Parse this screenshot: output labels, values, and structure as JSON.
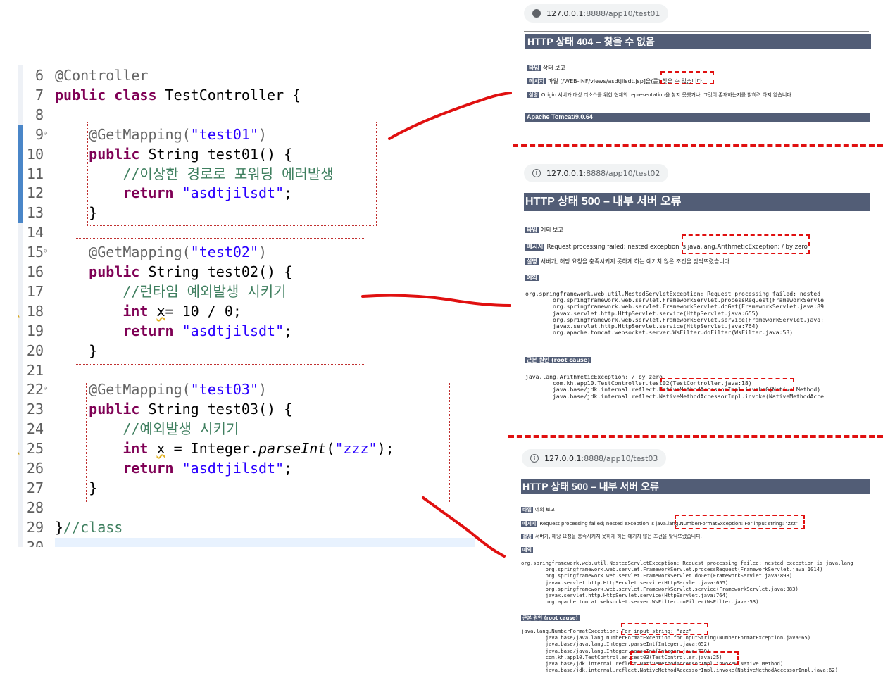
{
  "editor": {
    "lines": [
      {
        "n": "6",
        "t": [
          [
            "ann",
            "@Controller"
          ]
        ]
      },
      {
        "n": "7",
        "t": [
          [
            "kw",
            "public class "
          ],
          [
            "",
            "TestController {"
          ]
        ]
      },
      {
        "n": "8",
        "t": []
      },
      {
        "n": "9",
        "t": [
          [
            "",
            "    "
          ],
          [
            "ann",
            "@GetMapping("
          ],
          [
            "str",
            "\"test01\""
          ],
          [
            "ann",
            ")"
          ]
        ]
      },
      {
        "n": "10",
        "t": [
          [
            "",
            "    "
          ],
          [
            "kw",
            "public "
          ],
          [
            "",
            "String test01() {"
          ]
        ]
      },
      {
        "n": "11",
        "t": [
          [
            "",
            "        "
          ],
          [
            "cmt",
            "//이상한 경로로 포워딩 에러발생"
          ]
        ]
      },
      {
        "n": "12",
        "t": [
          [
            "",
            "        "
          ],
          [
            "kw",
            "return "
          ],
          [
            "str",
            "\"asdtjilsdt\""
          ],
          [
            "",
            ";"
          ]
        ]
      },
      {
        "n": "13",
        "t": [
          [
            "",
            "    }"
          ]
        ]
      },
      {
        "n": "14",
        "t": []
      },
      {
        "n": "15",
        "t": [
          [
            "",
            "    "
          ],
          [
            "ann",
            "@GetMapping("
          ],
          [
            "str",
            "\"test02\""
          ],
          [
            "ann",
            ")"
          ]
        ]
      },
      {
        "n": "16",
        "t": [
          [
            "",
            "    "
          ],
          [
            "kw",
            "public "
          ],
          [
            "",
            "String test02() {"
          ]
        ]
      },
      {
        "n": "17",
        "t": [
          [
            "",
            "        "
          ],
          [
            "cmt",
            "//런타임 예외발생 시키기"
          ]
        ]
      },
      {
        "n": "18",
        "t": [
          [
            "",
            "        "
          ],
          [
            "kw",
            "int "
          ],
          [
            "squig",
            "x"
          ],
          [
            "",
            "= 10 / 0;"
          ]
        ]
      },
      {
        "n": "19",
        "t": [
          [
            "",
            "        "
          ],
          [
            "kw",
            "return "
          ],
          [
            "str",
            "\"asdtjilsdt\""
          ],
          [
            "",
            ";"
          ]
        ]
      },
      {
        "n": "20",
        "t": [
          [
            "",
            "    }"
          ]
        ]
      },
      {
        "n": "21",
        "t": []
      },
      {
        "n": "22",
        "t": [
          [
            "",
            "    "
          ],
          [
            "ann",
            "@GetMapping("
          ],
          [
            "str",
            "\"test03\""
          ],
          [
            "ann",
            ")"
          ]
        ]
      },
      {
        "n": "23",
        "t": [
          [
            "",
            "    "
          ],
          [
            "kw",
            "public "
          ],
          [
            "",
            "String test03() {"
          ]
        ]
      },
      {
        "n": "24",
        "t": [
          [
            "",
            "        "
          ],
          [
            "cmt",
            "//예외발생 시키기"
          ]
        ]
      },
      {
        "n": "25",
        "t": [
          [
            "",
            "        "
          ],
          [
            "kw",
            "int "
          ],
          [
            "squig",
            "x"
          ],
          [
            "",
            " = Integer."
          ],
          [
            "it",
            "parseInt"
          ],
          [
            "",
            "("
          ],
          [
            "str",
            "\"zzz\""
          ],
          [
            "",
            ");"
          ]
        ]
      },
      {
        "n": "26",
        "t": [
          [
            "",
            "        "
          ],
          [
            "kw",
            "return "
          ],
          [
            "str",
            "\"asdtjilsdt\""
          ],
          [
            "",
            ";"
          ]
        ]
      },
      {
        "n": "27",
        "t": [
          [
            "",
            "    }"
          ]
        ]
      },
      {
        "n": "28",
        "t": []
      },
      {
        "n": "29",
        "t": [
          [
            "",
            "}"
          ],
          [
            "cmt",
            "//class"
          ]
        ]
      }
    ],
    "cut_line_number": "30"
  },
  "panel1": {
    "url_host": "127.0.0.1",
    "url_path": ":8888/app10/test01",
    "title": "HTTP 상태 404 – 찾을 수 없음",
    "type_label": "타입",
    "type_value": "상태 보고",
    "message_label": "메시지",
    "message_value": "파일 [/WEB-INF/views/asdtjilsdt.jsp]을(를) 찾을 수 없습니다.",
    "desc_label": "설명",
    "desc_value": "Origin 서버가 대상 리소스를 위한 현재의 representation을 찾지 못했거나, 그것이 존재하는지를 밝히려 하지 않습니다.",
    "footer": "Apache Tomcat/9.0.64"
  },
  "panel2": {
    "url_host": "127.0.0.1",
    "url_path": ":8888/app10/test02",
    "title": "HTTP 상태 500 – 내부 서버 오류",
    "type_label": "타입",
    "type_value": "예외 보고",
    "message_label": "메시지",
    "message_value": "Request processing failed; nested exception is java.lang.ArithmeticException: / by zero",
    "desc_label": "설명",
    "desc_value": "서버가, 해당 요청을 충족시키지 못하게 하는 예기치 않은 조건을 맞닥뜨렸습니다.",
    "exception_label": "예외",
    "stack": [
      "org.springframework.web.util.NestedServletException: Request processing failed; nested",
      "        org.springframework.web.servlet.FrameworkServlet.processRequest(FrameworkServle",
      "        org.springframework.web.servlet.FrameworkServlet.doGet(FrameworkServlet.java:89",
      "        javax.servlet.http.HttpServlet.service(HttpServlet.java:655)",
      "        org.springframework.web.servlet.FrameworkServlet.service(FrameworkServlet.java:",
      "        javax.servlet.http.HttpServlet.service(HttpServlet.java:764)",
      "        org.apache.tomcat.websocket.server.WsFilter.doFilter(WsFilter.java:53)"
    ],
    "root_label": "근본 원인 (root cause)",
    "root": [
      "java.lang.ArithmeticException: / by zero",
      "        com.kh.app10.TestController.test02(TestController.java:18)",
      "        java.base/jdk.internal.reflect.NativeMethodAccessorImpl.invoke0(Native Method)",
      "        java.base/jdk.internal.reflect.NativeMethodAccessorImpl.invoke(NativeMethodAcce"
    ]
  },
  "panel3": {
    "url_host": "127.0.0.1",
    "url_path": ":8888/app10/test03",
    "title": "HTTP 상태 500 – 내부 서버 오류",
    "type_label": "타입",
    "type_value": "예외 보고",
    "message_label": "메시지",
    "message_value": "Request processing failed; nested exception is java.lang.NumberFormatException: For input string: \"zzz\"",
    "desc_label": "설명",
    "desc_value": "서버가, 해당 요청을 충족시키지 못하게 하는 예기치 않은 조건을 맞닥뜨렸습니다.",
    "exception_label": "예외",
    "stack": [
      "org.springframework.web.util.NestedServletException: Request processing failed; nested exception is java.lang",
      "        org.springframework.web.servlet.FrameworkServlet.processRequest(FrameworkServlet.java:1014)",
      "        org.springframework.web.servlet.FrameworkServlet.doGet(FrameworkServlet.java:898)",
      "        javax.servlet.http.HttpServlet.service(HttpServlet.java:655)",
      "        org.springframework.web.servlet.FrameworkServlet.service(FrameworkServlet.java:883)",
      "        javax.servlet.http.HttpServlet.service(HttpServlet.java:764)",
      "        org.apache.tomcat.websocket.server.WsFilter.doFilter(WsFilter.java:53)"
    ],
    "root_label": "근본 원인 (root cause)",
    "root": [
      "java.lang.NumberFormatException: For input string: \"zzz\"",
      "        java.base/java.lang.NumberFormatException.forInputString(NumberFormatException.java:65)",
      "        java.base/java.lang.Integer.parseInt(Integer.java:652)",
      "        java.base/java.lang.Integer.parseInt(Integer.java:770)",
      "        com.kh.app10.TestController.test03(TestController.java:25)",
      "        java.base/jdk.internal.reflect.NativeMethodAccessorImpl.invoke0(Native Method)",
      "        java.base/jdk.internal.reflect.NativeMethodAccessorImpl.invoke(NativeMethodAccessorImpl.java:62)"
    ]
  },
  "colors": {
    "annotation": "#e01010",
    "tomcat_header": "#525d76",
    "keyword": "#7f0055",
    "string": "#2a00ff",
    "comment": "#3f7f5f"
  }
}
